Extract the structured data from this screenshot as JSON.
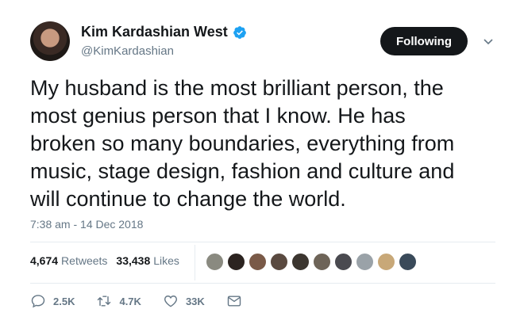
{
  "author": {
    "display_name": "Kim Kardashian West",
    "handle": "@KimKardashian",
    "verified": true
  },
  "follow_button_label": "Following",
  "tweet_text": "My husband is the most brilliant person, the\nmost genius person that I know. He has\nbroken so many boundaries, everything from\nmusic, stage design, fashion and culture and\nwill continue to change the world.",
  "timestamp": "7:38 am - 14 Dec 2018",
  "stats": {
    "retweets_value": "4,674",
    "retweets_label": "Retweets",
    "likes_value": "33,438",
    "likes_label": "Likes"
  },
  "liker_avatars": [
    {
      "name": "liker-avatar-1",
      "color": "#8a8a80"
    },
    {
      "name": "liker-avatar-2",
      "color": "#2b2320"
    },
    {
      "name": "liker-avatar-3",
      "color": "#7a5a48"
    },
    {
      "name": "liker-avatar-4",
      "color": "#5a4a40"
    },
    {
      "name": "liker-avatar-5",
      "color": "#3c3630"
    },
    {
      "name": "liker-avatar-6",
      "color": "#6e6458"
    },
    {
      "name": "liker-avatar-7",
      "color": "#4a4a50"
    },
    {
      "name": "liker-avatar-8",
      "color": "#9aa2a8"
    },
    {
      "name": "liker-avatar-9",
      "color": "#c8a878"
    },
    {
      "name": "liker-avatar-10",
      "color": "#3a4a5a"
    }
  ],
  "actions": {
    "reply_count": "2.5K",
    "retweet_count": "4.7K",
    "like_count": "33K"
  },
  "colors": {
    "text": "#14171a",
    "secondary": "#657786",
    "verified_blue": "#1da1f2",
    "divider": "#e6ecf0"
  },
  "icons": [
    "verified-badge-icon",
    "chevron-down-icon",
    "reply-icon",
    "retweet-icon",
    "like-heart-icon",
    "direct-message-icon"
  ]
}
